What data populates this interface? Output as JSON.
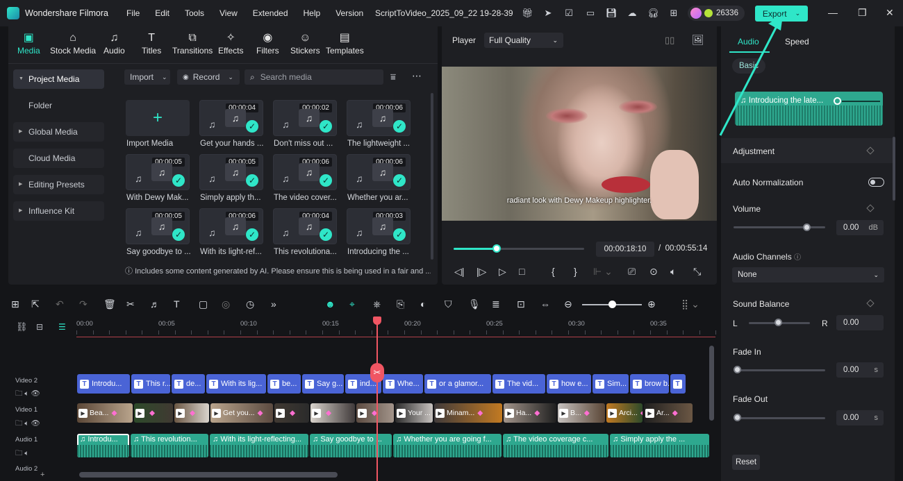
{
  "titlebar": {
    "app_name": "Wondershare Filmora",
    "menu": [
      "File",
      "Edit",
      "Tools",
      "View",
      "Extended",
      "Help",
      "Version"
    ],
    "project_name": "ScriptToVideo_2025_09_22 19-28-39",
    "credits": "26336",
    "export_label": "Export"
  },
  "media_tabs": [
    "Media",
    "Stock Media",
    "Audio",
    "Titles",
    "Transitions",
    "Effects",
    "Filters",
    "Stickers",
    "Templates"
  ],
  "sidebar": [
    "Project Media",
    "Folder",
    "Global Media",
    "Cloud Media",
    "Editing Presets",
    "Influence Kit"
  ],
  "toolbar": {
    "import_label": "Import",
    "record_label": "Record",
    "search_placeholder": "Search media"
  },
  "media_tiles": [
    {
      "label": "Import Media",
      "duration": ""
    },
    {
      "label": "Get your hands ...",
      "duration": "00:00:04"
    },
    {
      "label": "Don't miss out ...",
      "duration": "00:00:02"
    },
    {
      "label": "The lightweight ...",
      "duration": "00:00:06"
    },
    {
      "label": "With Dewy Mak...",
      "duration": "00:00:05"
    },
    {
      "label": "Simply apply th...",
      "duration": "00:00:05"
    },
    {
      "label": "The video cover...",
      "duration": "00:00:06"
    },
    {
      "label": "Whether you ar...",
      "duration": "00:00:06"
    },
    {
      "label": "Say goodbye to ...",
      "duration": "00:00:05"
    },
    {
      "label": "With its light-ref...",
      "duration": "00:00:06"
    },
    {
      "label": "This revolutiona...",
      "duration": "00:00:04"
    },
    {
      "label": "Introducing the ...",
      "duration": "00:00:03"
    }
  ],
  "ai_notice": "Includes some content generated by AI. Please ensure this is being used in a fair and ...",
  "player": {
    "label": "Player",
    "quality": "Full Quality",
    "subtitle": "radiant look with Dewy Makeup highlighter.",
    "current_time": "00:00:18:10",
    "separator": "/",
    "total_time": "00:00:55:14",
    "progress": 0.33
  },
  "props": {
    "tabs": [
      "Audio",
      "Speed"
    ],
    "basic": "Basic",
    "clip_title": "Introducing the late...",
    "adjustment": "Adjustment",
    "auto_normalization": "Auto Normalization",
    "volume": "Volume",
    "volume_value": "0.00",
    "volume_unit": "dB",
    "audio_channels": "Audio Channels",
    "audio_channels_value": "None",
    "sound_balance": "Sound Balance",
    "balance_l": "L",
    "balance_r": "R",
    "balance_value": "0.00",
    "fade_in": "Fade In",
    "fade_in_value": "0.00",
    "fade_out": "Fade Out",
    "fade_out_value": "0.00",
    "sec_unit": "s",
    "reset": "Reset"
  },
  "ruler": [
    "00:00",
    "00:05",
    "00:10",
    "00:15",
    "00:20",
    "00:25",
    "00:30",
    "00:35"
  ],
  "tracks": [
    "Video 2",
    "Video 1",
    "Audio 1",
    "Audio 2"
  ],
  "title_clips": [
    "Introdu...",
    "This r...",
    "de...",
    "With its lig...",
    "be...",
    "Say g...",
    "ind...",
    "Whe...",
    "or a glamor...",
    "The vid...",
    "how e...",
    "Sim...",
    "brow b...",
    ""
  ],
  "video_clips": [
    "Bea...",
    "",
    "",
    "Get you...",
    "",
    "",
    "",
    "Your ...",
    "Minam...",
    "Ha...",
    "B...",
    "Arci...",
    "Ar..."
  ],
  "audio_clips": [
    "Introdu...",
    "This revolution...",
    "With its light-reflecting...",
    "Say goodbye to ...",
    "Whether you are going f...",
    "The video coverage c...",
    "Simply apply the ..."
  ]
}
